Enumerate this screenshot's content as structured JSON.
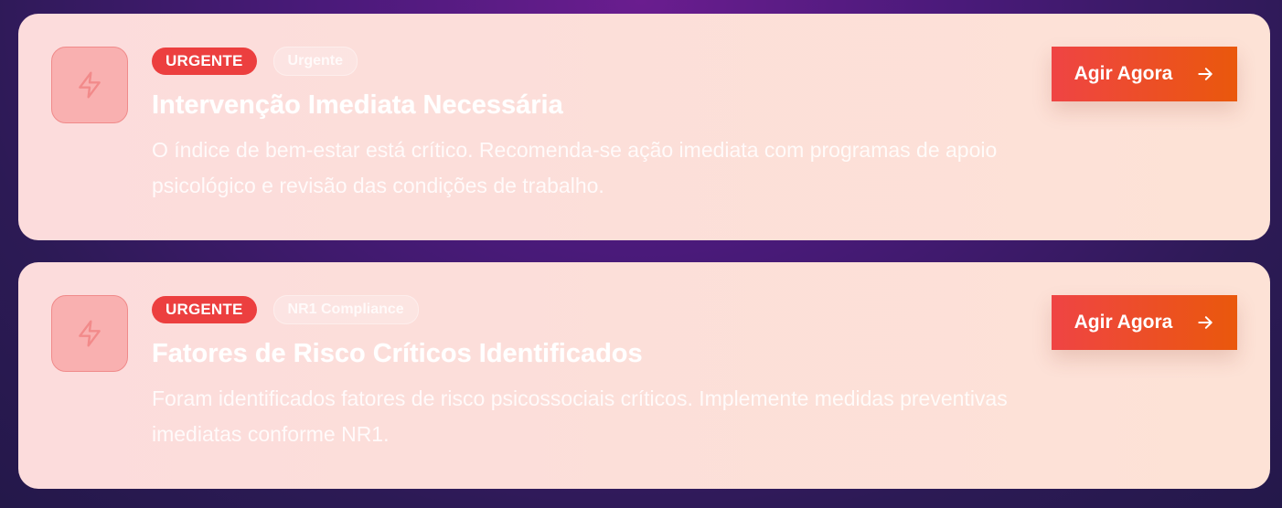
{
  "cards": [
    {
      "badge_priority": "URGENTE",
      "badge_category": "Urgente",
      "title": "Intervenção Imediata Necessária",
      "description": "O índice de bem-estar está crítico. Recomenda-se ação imediata com programas de apoio psicológico e revisão das condições de trabalho.",
      "action_label": "Agir Agora",
      "icon": "lightning-icon"
    },
    {
      "badge_priority": "URGENTE",
      "badge_category": "NR1 Compliance",
      "title": "Fatores de Risco Críticos Identificados",
      "description": "Foram identificados fatores de risco psicossociais críticos. Implemente medidas preventivas imediatas conforme NR1.",
      "action_label": "Agir Agora",
      "icon": "lightning-icon"
    }
  ],
  "colors": {
    "urgent_badge": "#ec3f3f",
    "button_gradient_start": "#ef4444",
    "button_gradient_end": "#ea580c",
    "card_background": "#fde0d8"
  }
}
